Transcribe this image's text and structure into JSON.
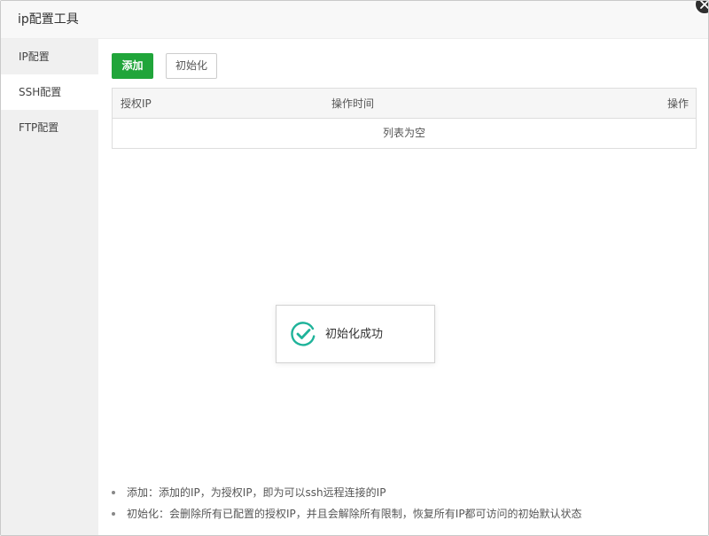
{
  "dialog": {
    "title": "ip配置工具"
  },
  "sidebar": {
    "items": [
      {
        "label": "IP配置"
      },
      {
        "label": "SSH配置"
      },
      {
        "label": "FTP配置"
      }
    ],
    "active_index": 1
  },
  "toolbar": {
    "add_label": "添加",
    "init_label": "初始化"
  },
  "table": {
    "columns": [
      "授权IP",
      "操作时间",
      "操作"
    ],
    "empty_text": "列表为空"
  },
  "toast": {
    "message": "初始化成功"
  },
  "notes": [
    "添加：添加的IP，为授权IP，即为可以ssh远程连接的IP",
    "初始化：会删除所有已配置的授权IP，并且会解除所有限制，恢复所有IP都可访问的初始默认状态"
  ],
  "colors": {
    "accent": "#20a53a",
    "success_icon": "#1fb39a",
    "sidebar_bg": "#f0f0f0"
  },
  "icons": {
    "close": "close-icon",
    "toast": "check-circle-icon"
  }
}
